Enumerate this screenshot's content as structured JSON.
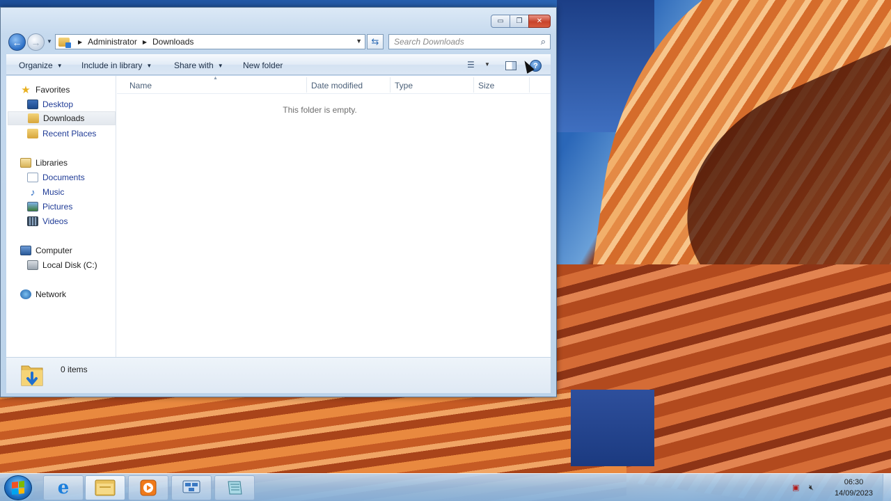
{
  "window": {
    "controls": {
      "minimize": "▭",
      "maximize": "❐",
      "close": "✕"
    },
    "address": {
      "crumbs": [
        "Administrator",
        "Downloads"
      ]
    },
    "search": {
      "placeholder": "Search Downloads"
    },
    "toolbar": {
      "organize": "Organize",
      "include_in_library": "Include in library",
      "share_with": "Share with",
      "new_folder": "New folder"
    },
    "nav": {
      "favorites": {
        "label": "Favorites",
        "items": [
          "Desktop",
          "Downloads",
          "Recent Places"
        ]
      },
      "libraries": {
        "label": "Libraries",
        "items": [
          "Documents",
          "Music",
          "Pictures",
          "Videos"
        ]
      },
      "computer": {
        "label": "Computer",
        "items": [
          "Local Disk (C:)"
        ]
      },
      "network": {
        "label": "Network"
      },
      "selected": "Downloads"
    },
    "columns": [
      "Name",
      "Date modified",
      "Type",
      "Size"
    ],
    "empty_message": "This folder is empty.",
    "details": {
      "count": "0 items"
    }
  },
  "taskbar": {
    "clock": {
      "time": "06:30",
      "date": "14/09/2023"
    }
  },
  "icons": {
    "start": "windows-logo-icon",
    "taskbar": [
      "internet-explorer-icon",
      "file-explorer-icon",
      "media-player-icon",
      "network-manager-icon",
      "notepad-icon"
    ],
    "tray": [
      "network-disconnected-icon",
      "volume-muted-icon"
    ]
  },
  "colors": {
    "link": "#1f3b96",
    "window_frame": "#c5d9ee",
    "close_button": "#c8442c"
  }
}
